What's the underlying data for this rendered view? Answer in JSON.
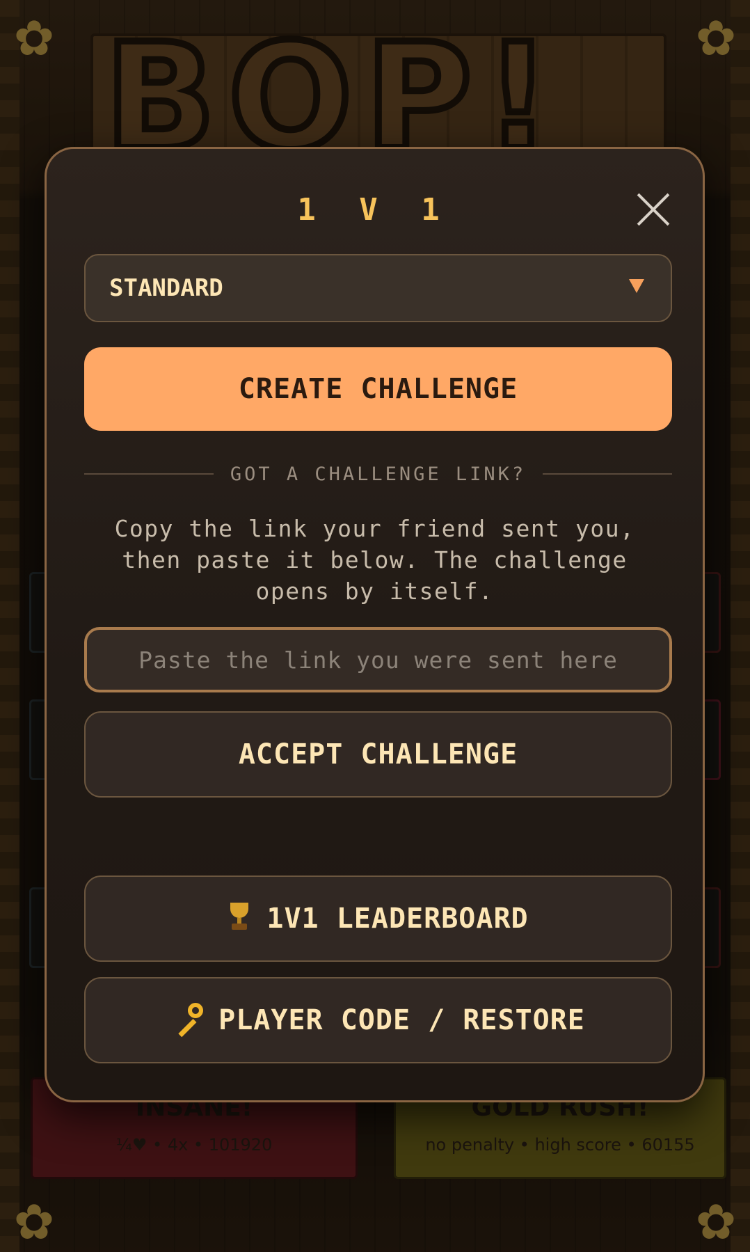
{
  "background": {
    "logo_text": "BOP!",
    "cards": [
      {
        "title": "INSANE!",
        "subtitle": "¼♥ • 4x • 101920",
        "color": "#6a1a1f"
      },
      {
        "title": "GOLD RUSH!",
        "subtitle": "no penalty • high score • 60155",
        "color": "#6e6516"
      }
    ]
  },
  "modal": {
    "title": "1 V 1",
    "mode_select": {
      "value": "STANDARD"
    },
    "create_button": "CREATE CHALLENGE",
    "divider_text": "GOT A CHALLENGE LINK?",
    "help_text": "Copy the link your friend sent you, then paste it below. The challenge opens by itself.",
    "link_input": {
      "placeholder": "Paste the link you were sent here",
      "value": ""
    },
    "accept_button": "ACCEPT CHALLENGE",
    "leaderboard_button": "1V1 LEADERBOARD",
    "restore_button": "PLAYER CODE / RESTORE"
  },
  "icons": {
    "close": "close-icon",
    "dropdown": "chevron-down-icon",
    "leaderboard": "trophy-icon",
    "restore": "key-icon"
  },
  "colors": {
    "accent": "#ffa866",
    "title": "#f7c35b",
    "button_text": "#fde6b5",
    "modal_bg": "#241c17",
    "modal_border": "#8a6543"
  }
}
